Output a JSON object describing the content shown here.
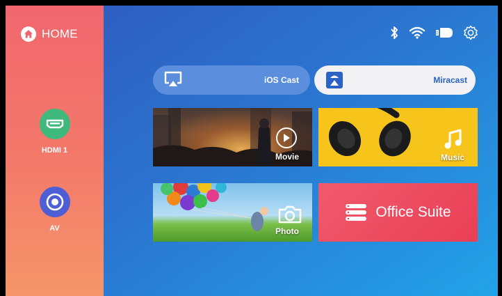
{
  "sidebar": {
    "home_label": "HOME",
    "items": [
      {
        "label": "HDMI 1",
        "icon": "hdmi-icon",
        "color": "#3fb97c"
      },
      {
        "label": "AV",
        "icon": "av-icon",
        "color": "#4e5fd6"
      }
    ]
  },
  "status_icons": [
    "bluetooth-icon",
    "wifi-icon",
    "usb-drive-icon",
    "gear-icon"
  ],
  "cast": {
    "ios_label": "iOS Cast",
    "miracast_label": "Miracast"
  },
  "tiles": {
    "movie": {
      "label": "Movie"
    },
    "music": {
      "label": "Music"
    },
    "photo": {
      "label": "Photo"
    },
    "office": {
      "label": "Office Suite"
    }
  },
  "colors": {
    "sidebar_top": "#f1666e",
    "sidebar_bottom": "#f5966a",
    "main_start": "#2f5fc1",
    "main_end": "#22a3e8",
    "music_bg": "#f6c41b",
    "office_bg": "#ea3f56",
    "miracast_text": "#2b62c6"
  }
}
